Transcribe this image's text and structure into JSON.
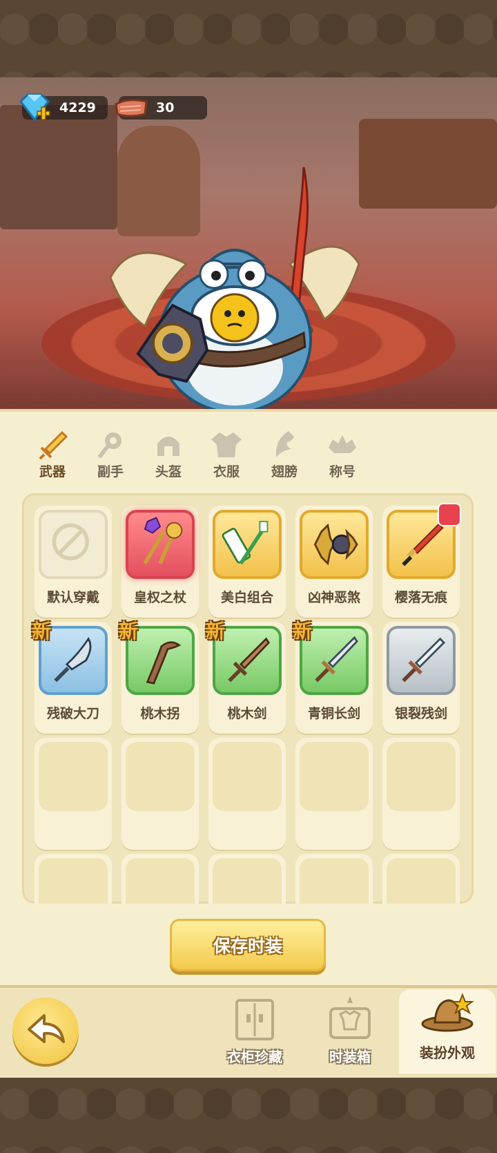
{
  "currency": {
    "diamonds": "4229",
    "tickets": "30"
  },
  "tabs": [
    {
      "label": "武器",
      "icon": "sword-icon",
      "active": true
    },
    {
      "label": "副手",
      "icon": "offhand-icon"
    },
    {
      "label": "头盔",
      "icon": "helmet-icon"
    },
    {
      "label": "衣服",
      "icon": "clothes-icon"
    },
    {
      "label": "翅膀",
      "icon": "wings-icon"
    },
    {
      "label": "称号",
      "icon": "title-icon"
    }
  ],
  "items": [
    {
      "name": "默认穿戴",
      "rarity": "default"
    },
    {
      "name": "皇权之杖",
      "rarity": "red"
    },
    {
      "name": "美白组合",
      "rarity": "gold"
    },
    {
      "name": "凶神恶煞",
      "rarity": "gold"
    },
    {
      "name": "樱落无痕",
      "rarity": "gold",
      "equipped": true
    },
    {
      "name": "残破大刀",
      "rarity": "blue",
      "new": "新"
    },
    {
      "name": "桃木拐",
      "rarity": "green",
      "new": "新"
    },
    {
      "name": "桃木剑",
      "rarity": "green",
      "new": "新"
    },
    {
      "name": "青铜长剑",
      "rarity": "green",
      "new": "新"
    },
    {
      "name": "银裂残剑",
      "rarity": "gray"
    }
  ],
  "save_button": "保存时装",
  "bottom_nav": [
    {
      "label": "衣柜珍藏",
      "icon": "wardrobe-icon"
    },
    {
      "label": "时装箱",
      "icon": "fashion-box-icon"
    },
    {
      "label": "装扮外观",
      "icon": "hat-icon",
      "active": true
    }
  ],
  "colors": {
    "accent": "#c77a24",
    "panel": "#f6efcf",
    "button": "#f3c94a"
  }
}
